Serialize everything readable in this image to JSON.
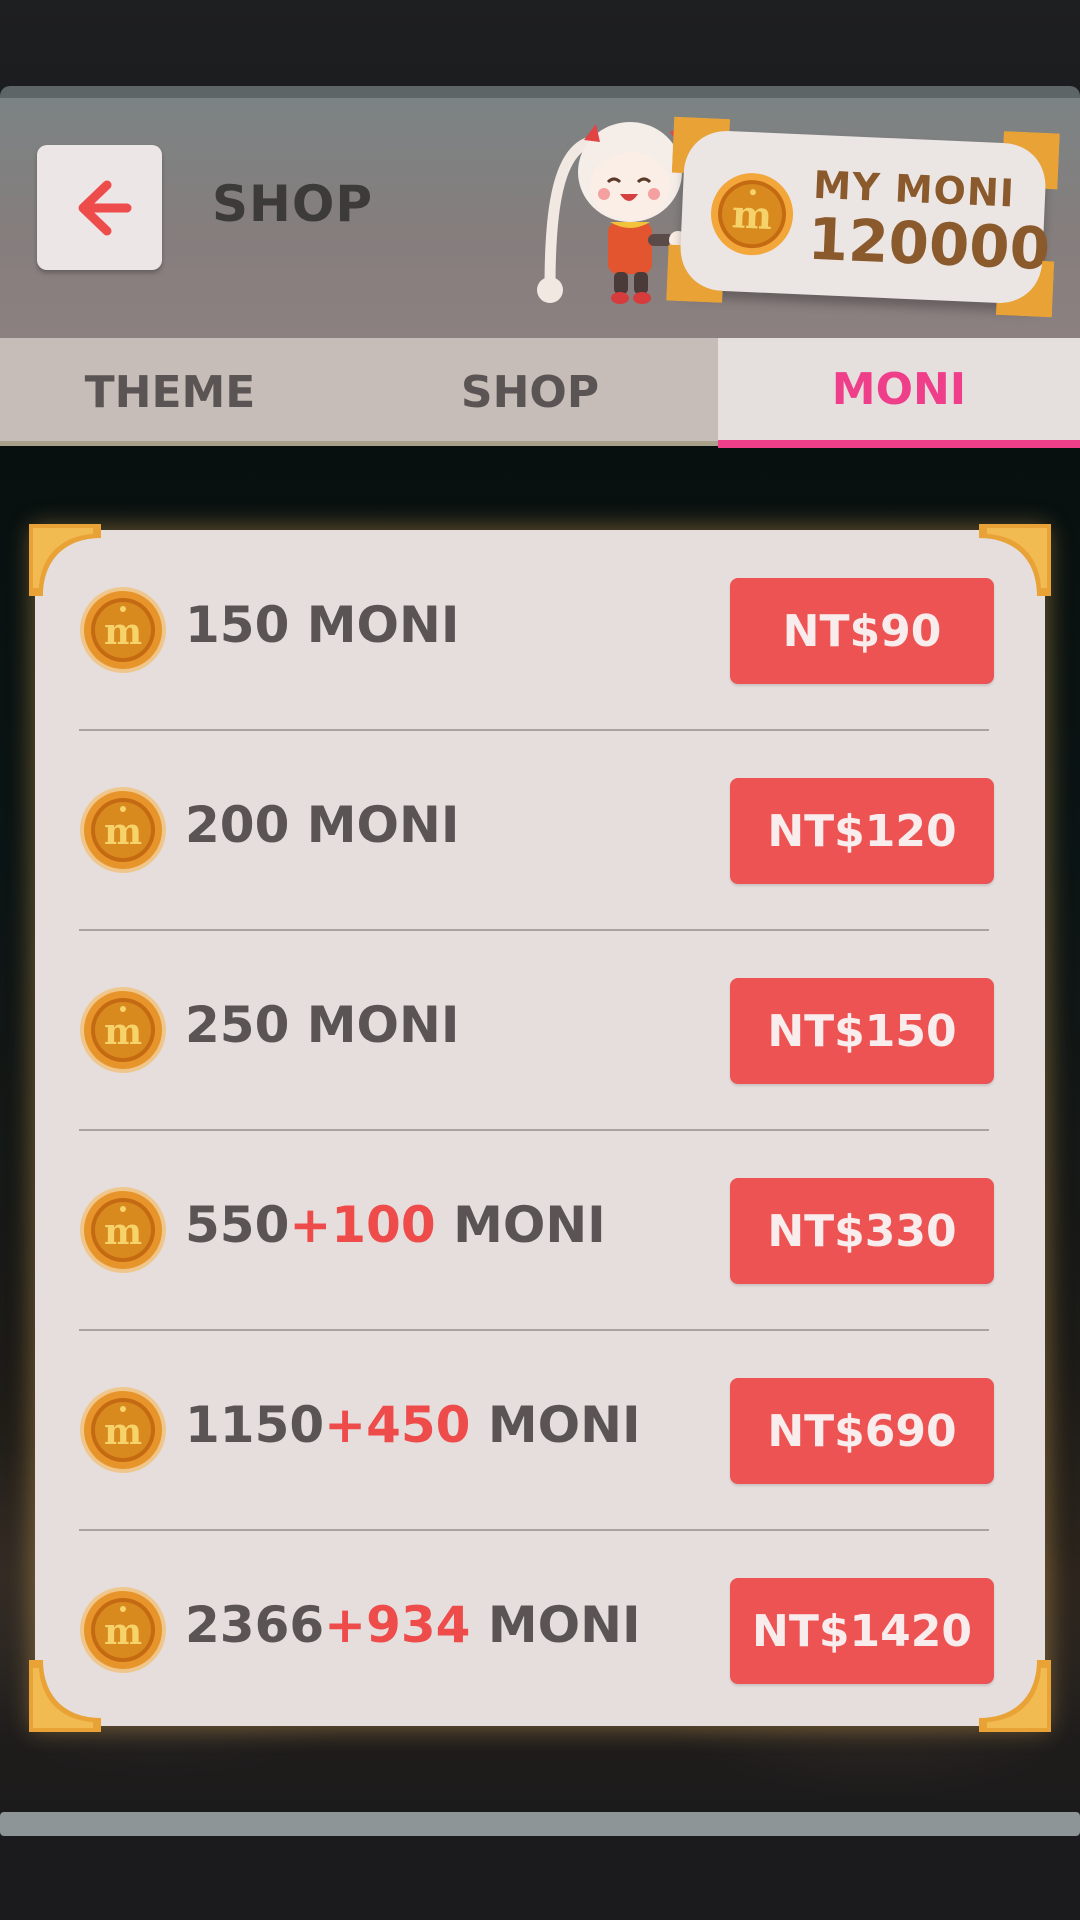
{
  "header": {
    "title": "SHOP",
    "back_icon": "arrow-left-icon",
    "balance": {
      "label": "MY MONI",
      "value": "120000",
      "coin_icon": "moni-coin-icon"
    }
  },
  "tabs": [
    {
      "label": "THEME",
      "active": false
    },
    {
      "label": "SHOP",
      "active": false
    },
    {
      "label": "MONI",
      "active": true
    }
  ],
  "packages": [
    {
      "base": "150",
      "bonus": "",
      "unit": "MONI",
      "price": "NT$90"
    },
    {
      "base": "200",
      "bonus": "",
      "unit": "MONI",
      "price": "NT$120"
    },
    {
      "base": "250",
      "bonus": "",
      "unit": "MONI",
      "price": "NT$150"
    },
    {
      "base": "550",
      "bonus": "+100",
      "unit": "MONI",
      "price": "NT$330"
    },
    {
      "base": "1150",
      "bonus": "+450",
      "unit": "MONI",
      "price": "NT$690"
    },
    {
      "base": "2366",
      "bonus": "+934",
      "unit": "MONI",
      "price": "NT$1420"
    }
  ],
  "colors": {
    "accent_pink": "#ef3e8a",
    "price_red": "#ee5353",
    "bonus_red": "#ee4b4b",
    "coin_gold": "#d98a1f"
  }
}
